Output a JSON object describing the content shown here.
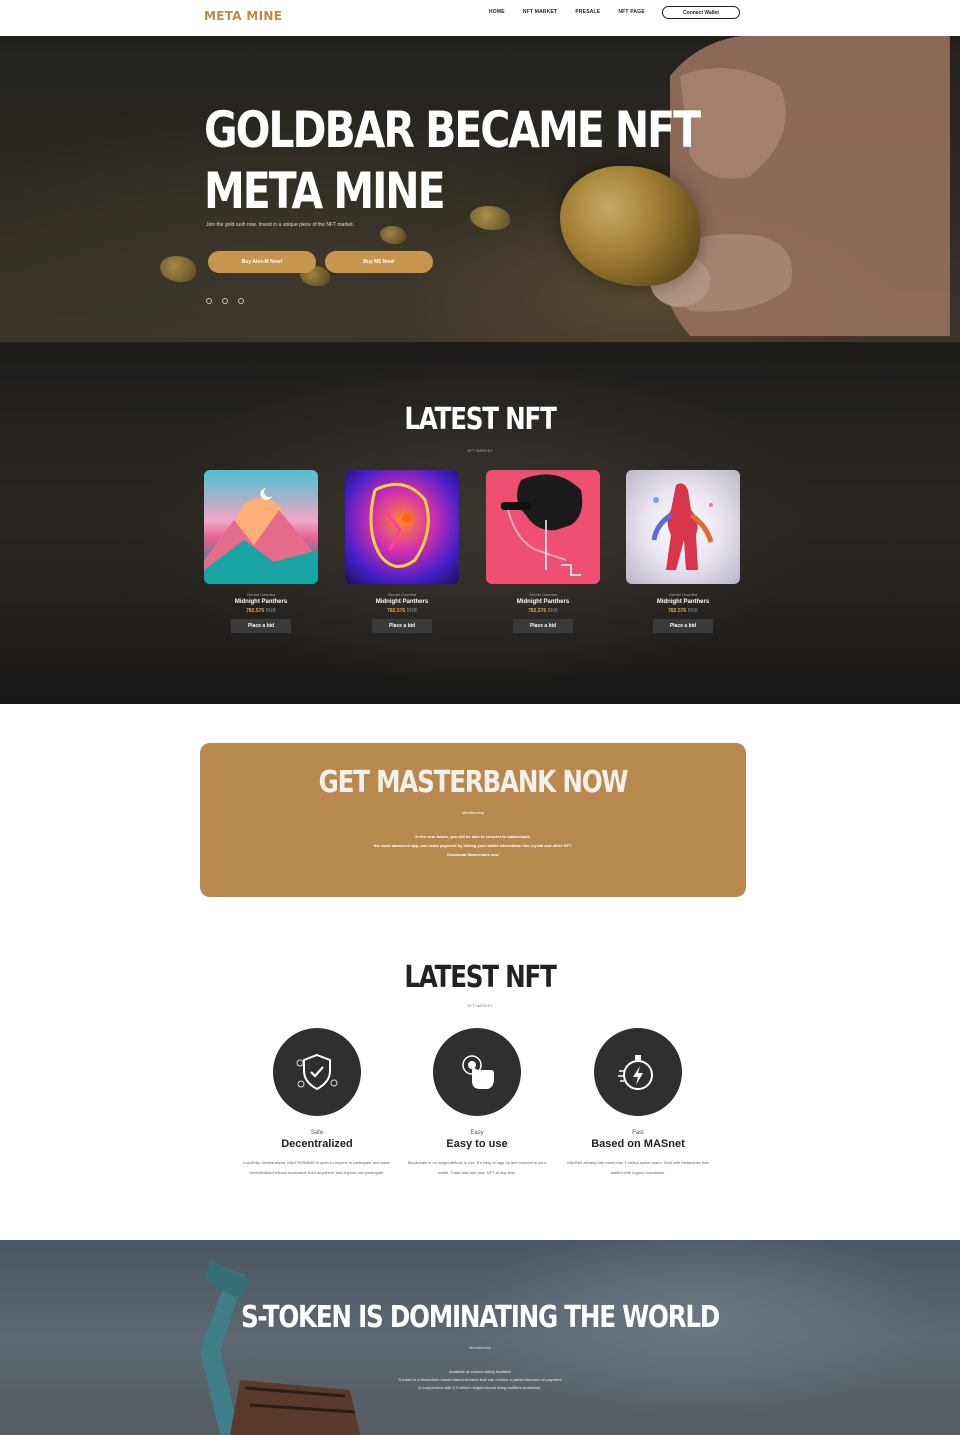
{
  "nav": {
    "brand": "META MINE",
    "links": [
      "HOME",
      "NFT MARKET",
      "PRESALE",
      "NFT PAGE"
    ],
    "connect_label": "Connect Wallet"
  },
  "hero": {
    "title_line1": "GOLDBAR BECAME NFT",
    "title_line2": "META MINE",
    "subtitle": "Join the gold rush now. Invest in a unique piece of the NFT market.",
    "btn1": "Buy Alex-M Now!",
    "btn2": "Buy M5 Now!"
  },
  "latest_nft": {
    "title": "LATEST NFT",
    "subtitle": "NFT MARKET",
    "cards": [
      {
        "author": "Gerald Ozumba",
        "name": "Midnight Panthers",
        "price": "782.576",
        "unit": "BNB",
        "bid": "Place a bid"
      },
      {
        "author": "Gerald Ozumba",
        "name": "Midnight Panthers",
        "price": "782.576",
        "unit": "BNB",
        "bid": "Place a bid"
      },
      {
        "author": "Gerald Ozumba",
        "name": "Midnight Panthers",
        "price": "782.576",
        "unit": "BNB",
        "bid": "Place a bid"
      },
      {
        "author": "Gerald Ozumba",
        "name": "Midnight Panthers",
        "price": "782.576",
        "unit": "BNB",
        "bid": "Place a bid"
      }
    ]
  },
  "banner": {
    "title": "GET MASTERBANK NOW",
    "subtitle": "Membership",
    "line1": "In the near future, you will be able to connect to masterbank,",
    "line2": "the most advanced app, and make payment by linking your wallet information like crystal and other NFT.",
    "line3": "Download Masterbank now"
  },
  "features": {
    "title": "LATEST NFT",
    "subtitle": "NFT MARKET",
    "items": [
      {
        "tag": "Safe",
        "title": "Decentralized",
        "icon": "shield-icon",
        "text": "LuxuFully decentralized, MASTERBANK is open to anyone to participate and trade. Decentralized means accessible from anywhere and anyone can participate."
      },
      {
        "tag": "Easy",
        "title": "Easy to use",
        "icon": "touch-icon",
        "text": "Blockchain is no longer difficult to use. It's easy to sign up and connect to your wallet. Trade and own your NFT at any time."
      },
      {
        "tag": "Fast",
        "title": "Based on MASnet",
        "icon": "stopwatch-icon",
        "text": "MASNet already has more than 1 million active users. Deal with Metamines that started with a good foundation."
      }
    ]
  },
  "stoken": {
    "title": "S-TOKEN IS DOMINATING THE WORLD",
    "subtitle": "Membership",
    "line1": "Available at various listing facilities!",
    "line2": "S-token is a blockchain based diamond token that can receive a partial discount on payment",
    "line3": "in conjunction with 2.3 million neighborhood living facilities worldwide."
  }
}
